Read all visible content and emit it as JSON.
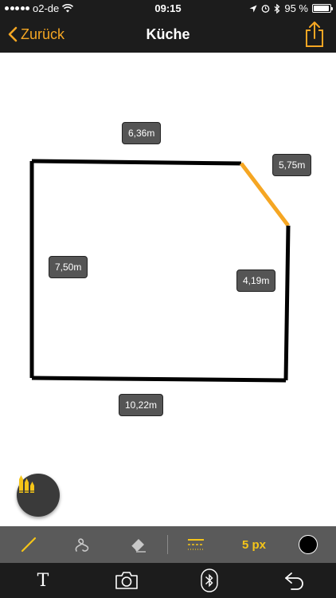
{
  "status_bar": {
    "carrier": "o2-de",
    "time": "09:15",
    "battery_text": "95 %",
    "battery_level": 0.95,
    "icons": [
      "signal-dots-icon",
      "wifi-icon",
      "location-icon",
      "alarm-icon",
      "bluetooth-icon",
      "battery-icon"
    ]
  },
  "nav": {
    "back_label": "Zurück",
    "title": "Küche",
    "share_icon": "share-icon"
  },
  "floorplan": {
    "measurements": [
      {
        "label": "6,36m",
        "wall": "top"
      },
      {
        "label": "5,75m",
        "wall": "diagonal-top-right"
      },
      {
        "label": "7,50m",
        "wall": "left"
      },
      {
        "label": "4,19m",
        "wall": "right"
      },
      {
        "label": "10,22m",
        "wall": "bottom"
      }
    ],
    "wall_color": "#000000",
    "selected_wall_color": "#f5a623"
  },
  "palette_button": {
    "icon": "color-pencils-icon"
  },
  "toolbar": {
    "tools": [
      {
        "name": "line-tool",
        "icon": "line-icon",
        "active": true
      },
      {
        "name": "freehand-tool",
        "icon": "freehand-icon",
        "active": false
      },
      {
        "name": "eraser-tool",
        "icon": "eraser-icon",
        "active": false
      },
      {
        "name": "line-style-tool",
        "icon": "line-style-icon",
        "active": false
      }
    ],
    "stroke_size_label": "5 px",
    "stroke_color": "#000000",
    "accent_color": "#f5c518"
  },
  "bottom_bar": {
    "items": [
      {
        "name": "text-tool",
        "icon": "text-icon",
        "glyph": "T"
      },
      {
        "name": "camera-tool",
        "icon": "camera-icon"
      },
      {
        "name": "bluetooth-tool",
        "icon": "bluetooth-icon"
      },
      {
        "name": "undo-tool",
        "icon": "undo-icon"
      }
    ]
  }
}
